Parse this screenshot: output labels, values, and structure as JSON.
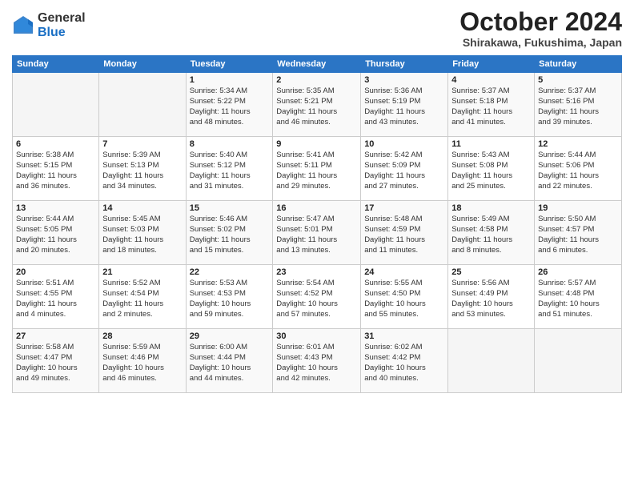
{
  "logo": {
    "general": "General",
    "blue": "Blue"
  },
  "title": "October 2024",
  "subtitle": "Shirakawa, Fukushima, Japan",
  "headers": [
    "Sunday",
    "Monday",
    "Tuesday",
    "Wednesday",
    "Thursday",
    "Friday",
    "Saturday"
  ],
  "rows": [
    [
      {
        "day": "",
        "info": ""
      },
      {
        "day": "",
        "info": ""
      },
      {
        "day": "1",
        "info": "Sunrise: 5:34 AM\nSunset: 5:22 PM\nDaylight: 11 hours\nand 48 minutes."
      },
      {
        "day": "2",
        "info": "Sunrise: 5:35 AM\nSunset: 5:21 PM\nDaylight: 11 hours\nand 46 minutes."
      },
      {
        "day": "3",
        "info": "Sunrise: 5:36 AM\nSunset: 5:19 PM\nDaylight: 11 hours\nand 43 minutes."
      },
      {
        "day": "4",
        "info": "Sunrise: 5:37 AM\nSunset: 5:18 PM\nDaylight: 11 hours\nand 41 minutes."
      },
      {
        "day": "5",
        "info": "Sunrise: 5:37 AM\nSunset: 5:16 PM\nDaylight: 11 hours\nand 39 minutes."
      }
    ],
    [
      {
        "day": "6",
        "info": "Sunrise: 5:38 AM\nSunset: 5:15 PM\nDaylight: 11 hours\nand 36 minutes."
      },
      {
        "day": "7",
        "info": "Sunrise: 5:39 AM\nSunset: 5:13 PM\nDaylight: 11 hours\nand 34 minutes."
      },
      {
        "day": "8",
        "info": "Sunrise: 5:40 AM\nSunset: 5:12 PM\nDaylight: 11 hours\nand 31 minutes."
      },
      {
        "day": "9",
        "info": "Sunrise: 5:41 AM\nSunset: 5:11 PM\nDaylight: 11 hours\nand 29 minutes."
      },
      {
        "day": "10",
        "info": "Sunrise: 5:42 AM\nSunset: 5:09 PM\nDaylight: 11 hours\nand 27 minutes."
      },
      {
        "day": "11",
        "info": "Sunrise: 5:43 AM\nSunset: 5:08 PM\nDaylight: 11 hours\nand 25 minutes."
      },
      {
        "day": "12",
        "info": "Sunrise: 5:44 AM\nSunset: 5:06 PM\nDaylight: 11 hours\nand 22 minutes."
      }
    ],
    [
      {
        "day": "13",
        "info": "Sunrise: 5:44 AM\nSunset: 5:05 PM\nDaylight: 11 hours\nand 20 minutes."
      },
      {
        "day": "14",
        "info": "Sunrise: 5:45 AM\nSunset: 5:03 PM\nDaylight: 11 hours\nand 18 minutes."
      },
      {
        "day": "15",
        "info": "Sunrise: 5:46 AM\nSunset: 5:02 PM\nDaylight: 11 hours\nand 15 minutes."
      },
      {
        "day": "16",
        "info": "Sunrise: 5:47 AM\nSunset: 5:01 PM\nDaylight: 11 hours\nand 13 minutes."
      },
      {
        "day": "17",
        "info": "Sunrise: 5:48 AM\nSunset: 4:59 PM\nDaylight: 11 hours\nand 11 minutes."
      },
      {
        "day": "18",
        "info": "Sunrise: 5:49 AM\nSunset: 4:58 PM\nDaylight: 11 hours\nand 8 minutes."
      },
      {
        "day": "19",
        "info": "Sunrise: 5:50 AM\nSunset: 4:57 PM\nDaylight: 11 hours\nand 6 minutes."
      }
    ],
    [
      {
        "day": "20",
        "info": "Sunrise: 5:51 AM\nSunset: 4:55 PM\nDaylight: 11 hours\nand 4 minutes."
      },
      {
        "day": "21",
        "info": "Sunrise: 5:52 AM\nSunset: 4:54 PM\nDaylight: 11 hours\nand 2 minutes."
      },
      {
        "day": "22",
        "info": "Sunrise: 5:53 AM\nSunset: 4:53 PM\nDaylight: 10 hours\nand 59 minutes."
      },
      {
        "day": "23",
        "info": "Sunrise: 5:54 AM\nSunset: 4:52 PM\nDaylight: 10 hours\nand 57 minutes."
      },
      {
        "day": "24",
        "info": "Sunrise: 5:55 AM\nSunset: 4:50 PM\nDaylight: 10 hours\nand 55 minutes."
      },
      {
        "day": "25",
        "info": "Sunrise: 5:56 AM\nSunset: 4:49 PM\nDaylight: 10 hours\nand 53 minutes."
      },
      {
        "day": "26",
        "info": "Sunrise: 5:57 AM\nSunset: 4:48 PM\nDaylight: 10 hours\nand 51 minutes."
      }
    ],
    [
      {
        "day": "27",
        "info": "Sunrise: 5:58 AM\nSunset: 4:47 PM\nDaylight: 10 hours\nand 49 minutes."
      },
      {
        "day": "28",
        "info": "Sunrise: 5:59 AM\nSunset: 4:46 PM\nDaylight: 10 hours\nand 46 minutes."
      },
      {
        "day": "29",
        "info": "Sunrise: 6:00 AM\nSunset: 4:44 PM\nDaylight: 10 hours\nand 44 minutes."
      },
      {
        "day": "30",
        "info": "Sunrise: 6:01 AM\nSunset: 4:43 PM\nDaylight: 10 hours\nand 42 minutes."
      },
      {
        "day": "31",
        "info": "Sunrise: 6:02 AM\nSunset: 4:42 PM\nDaylight: 10 hours\nand 40 minutes."
      },
      {
        "day": "",
        "info": ""
      },
      {
        "day": "",
        "info": ""
      }
    ]
  ]
}
